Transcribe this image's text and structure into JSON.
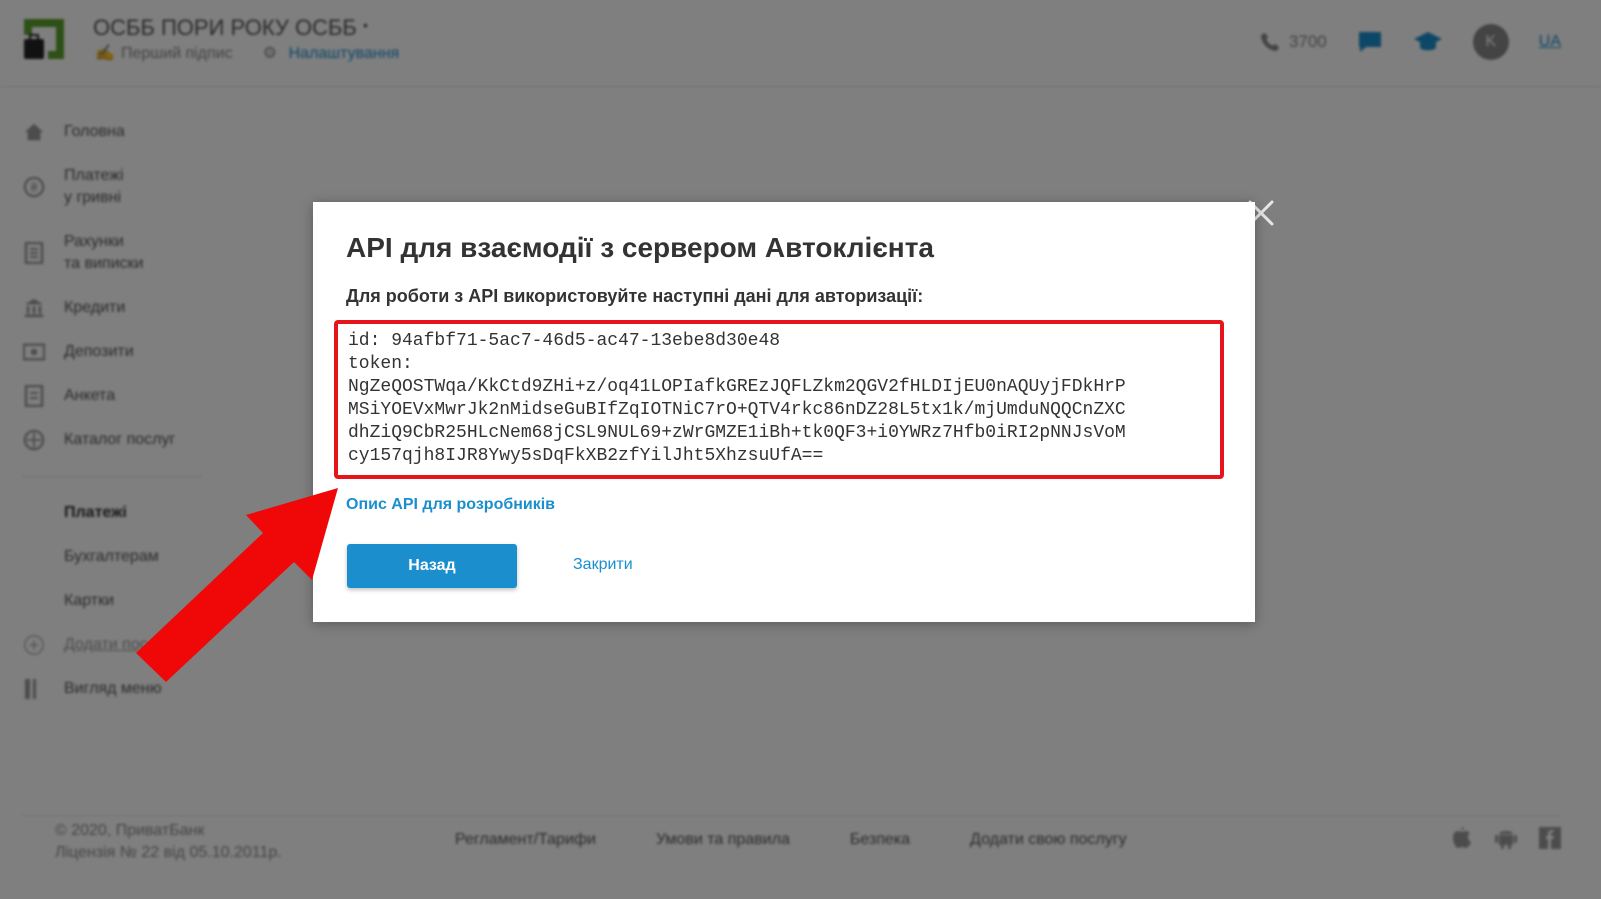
{
  "header": {
    "org_name": "ОСББ ПОРИ РОКУ ОСББ",
    "org_caret": "•",
    "first_sign": "Перший підпис",
    "settings": "Налаштування",
    "phone": "3700",
    "avatar_letter": "K",
    "lang": "UA"
  },
  "sidebar": {
    "items": [
      {
        "label": "Головна",
        "icon": "home-icon"
      },
      {
        "label": "Платежі\nу гривні",
        "icon": "hryvnia-icon"
      },
      {
        "label": "Рахунки\nта виписки",
        "icon": "statement-icon"
      },
      {
        "label": "Кредити",
        "icon": "bank-icon"
      },
      {
        "label": "Депозити",
        "icon": "deposit-icon"
      },
      {
        "label": "Анкета",
        "icon": "form-icon"
      },
      {
        "label": "Каталог послуг",
        "icon": "catalog-icon"
      }
    ],
    "section_title": "Платежі",
    "sub_items": [
      "Бухгалтерам",
      "Картки"
    ],
    "add_service": "Додати послугу",
    "menu_view": "Вигляд меню"
  },
  "footer": {
    "copyright": "© 2020, ПриватБанк",
    "license": "Ліцензія № 22 від 05.10.2011р.",
    "links": [
      "Регламент/Тарифи",
      "Умови та правила",
      "Безпека",
      "Додати свою послугу"
    ]
  },
  "modal": {
    "title": "API для взаємодії з сервером Автоклієнта",
    "subtitle": "Для роботи з API використовуйте наступні дані для авторизації:",
    "credentials": {
      "id_line": "id: 94afbf71-5ac7-46d5-ac47-13ebe8d30e48",
      "token_label": "token:",
      "token_lines": [
        "NgZeQOSTWqa/KkCtd9ZHi+z/oq41LOPIafkGREzJQFLZkm2QGV2fHLDIjEU0nAQUyjFDkHrP",
        "MSiYOEVxMwrJk2nMidseGuBIfZqIOTNiC7rO+QTV4rkc86nDZ28L5tx1k/mjUmduNQQCnZXC",
        "dhZiQ9CbR25HLcNem68jCSL9NUL69+zWrGMZE1iBh+tk0QF3+i0YWRz7Hfb0iRI2pNNJsVoM",
        "cy157qjh8IJR8Ywy5sDqFkXB2zfYilJht5XhzsuUfA=="
      ]
    },
    "api_link": "Опис API для розробників",
    "back_button": "Назад",
    "close_button": "Закрити"
  },
  "colors": {
    "accent": "#1b8fce",
    "highlight": "#e8141b",
    "brand_green": "#5aa02c"
  }
}
